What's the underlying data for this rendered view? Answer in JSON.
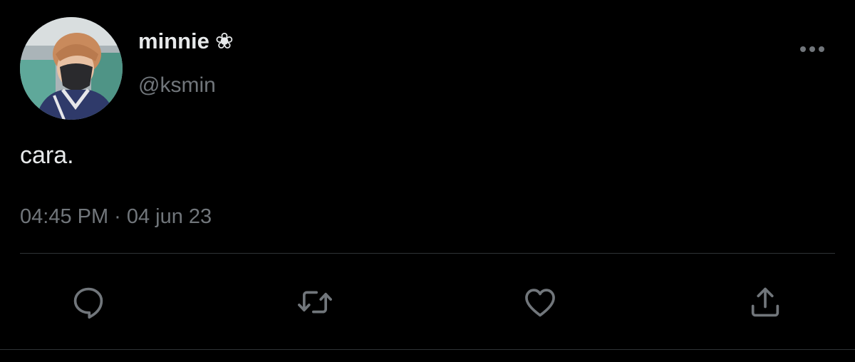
{
  "user": {
    "display_name": "minnie",
    "name_emoji": "❀",
    "handle": "@ksmin"
  },
  "tweet": {
    "text": "cara.",
    "time": "04:45 PM",
    "separator": "·",
    "date": "04 jun 23"
  },
  "actions": {
    "reply_icon": "reply-icon",
    "retweet_icon": "retweet-icon",
    "like_icon": "heart-icon",
    "share_icon": "share-icon",
    "more_icon": "more-icon"
  },
  "colors": {
    "background": "#000000",
    "text_primary": "#e7e9ea",
    "text_secondary": "#71767b",
    "divider": "#2f3336"
  }
}
